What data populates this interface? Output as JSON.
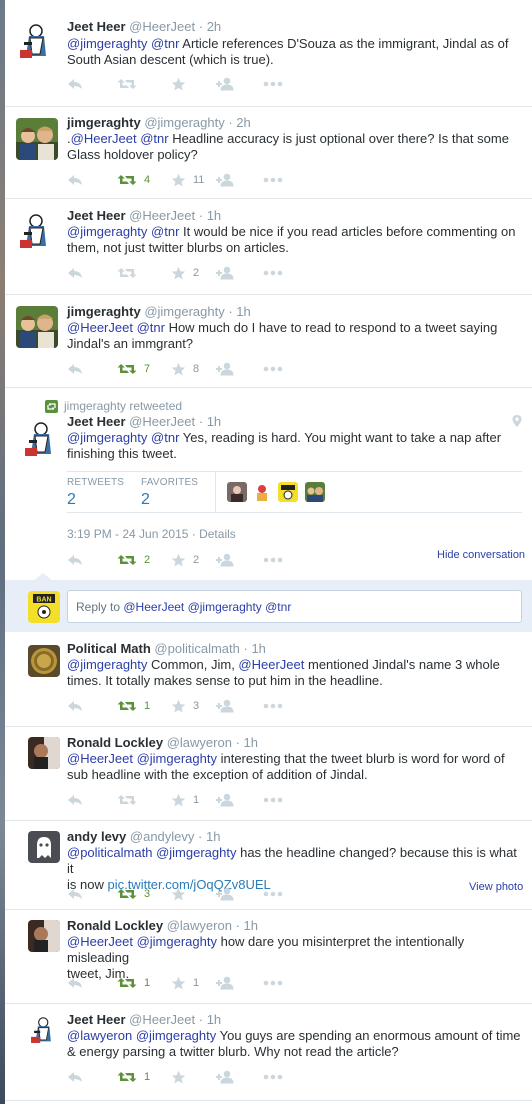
{
  "colors": {
    "link": "#2b3ea8",
    "retweet_active": "#5c913b",
    "muted": "#8899a6",
    "border": "#e1e8ed"
  },
  "tweets": [
    {
      "name": "Jeet Heer",
      "handle": "@HeerJeet",
      "time": "2h",
      "line1": [
        {
          "t": "@jimgeraghty",
          "m": true
        },
        {
          "t": " "
        },
        {
          "t": "@tnr",
          "m": true
        },
        {
          "t": " Article references D'Souza as the immigrant, Jindal as of"
        }
      ],
      "line2": "South Asian descent (which is true).",
      "retweets": "",
      "favorites": ""
    },
    {
      "name": "jimgeraghty",
      "handle": "@jimgeraghty",
      "time": "2h",
      "line1": [
        {
          "t": "."
        },
        {
          "t": "@HeerJeet",
          "m": true
        },
        {
          "t": "  "
        },
        {
          "t": "@tnr",
          "m": true
        },
        {
          "t": " Headline accuracy is just optional over there? Is that some"
        }
      ],
      "line2": "Glass holdover policy?",
      "retweets": "4",
      "favorites": "11"
    },
    {
      "name": "Jeet Heer",
      "handle": "@HeerJeet",
      "time": "1h",
      "line1": [
        {
          "t": "@jimgeraghty",
          "m": true
        },
        {
          "t": " "
        },
        {
          "t": "@tnr",
          "m": true
        },
        {
          "t": " It would be nice if you read articles before commenting on"
        }
      ],
      "line2": "them, not just twitter blurbs on articles.",
      "retweets": "",
      "favorites": "2"
    },
    {
      "name": "jimgeraghty",
      "handle": "@jimgeraghty",
      "time": "1h",
      "line1": [
        {
          "t": "@HeerJeet",
          "m": true
        },
        {
          "t": " "
        },
        {
          "t": "@tnr",
          "m": true
        },
        {
          "t": " How much do I have to read to respond to a tweet saying"
        }
      ],
      "line2": "Jindal's an immgrant?",
      "retweets": "7",
      "favorites": "8"
    }
  ],
  "focus": {
    "retweeted_by": "jimgeraghty retweeted",
    "name": "Jeet Heer",
    "handle": "@HeerJeet",
    "time": "1h",
    "line1": [
      {
        "t": "@jimgeraghty",
        "m": true
      },
      {
        "t": " "
      },
      {
        "t": "@tnr",
        "m": true
      },
      {
        "t": " Yes, reading is hard. You might want to take a nap after"
      }
    ],
    "line2": "finishing this tweet.",
    "retweets_label": "RETWEETS",
    "retweets": "2",
    "favorites_label": "FAVORITES",
    "favorites": "2",
    "timestamp": "3:19 PM - 24 Jun 2015",
    "details": "Details",
    "hide_conversation": "Hide conversation",
    "reply_prefix": "Reply to ",
    "reply_mentions": "@HeerJeet @jimgeraghty @tnr"
  },
  "replies": [
    {
      "name": "Political Math",
      "handle": "@politicalmath",
      "time": "1h",
      "line1": [
        {
          "t": "@jimgeraghty",
          "m": true
        },
        {
          "t": " Common, Jim, "
        },
        {
          "t": "@HeerJeet",
          "m": true
        },
        {
          "t": " mentioned Jindal's name 3 whole"
        }
      ],
      "line2": "times. It totally makes sense to put him in the headline.",
      "retweets": "1",
      "favorites": "3"
    },
    {
      "name": "Ronald Lockley",
      "handle": "@lawyeron",
      "time": "1h",
      "line1": [
        {
          "t": "@HeerJeet",
          "m": true
        },
        {
          "t": " "
        },
        {
          "t": "@jimgeraghty",
          "m": true
        },
        {
          "t": " interesting that the tweet blurb is word for word of"
        }
      ],
      "line2": "sub headline with the exception of addition of Jindal.",
      "retweets": "",
      "favorites": "1"
    },
    {
      "name": "andy levy",
      "handle": "@andylevy",
      "time": "1h",
      "line1": [
        {
          "t": "@politicalmath",
          "m": true
        },
        {
          "t": " "
        },
        {
          "t": "@jimgeraghty",
          "m": true
        },
        {
          "t": " has the headline changed? because this is what it"
        }
      ],
      "line2_prefix": "is now ",
      "line2_link": "pic.twitter.com/jOqQZv8UEL",
      "view_photo": "View photo",
      "retweets": "3",
      "favorites": ""
    },
    {
      "name": "Ronald Lockley",
      "handle": "@lawyeron",
      "time": "1h",
      "line1": [
        {
          "t": "@HeerJeet",
          "m": true
        },
        {
          "t": " "
        },
        {
          "t": "@jimgeraghty",
          "m": true
        },
        {
          "t": " how dare you misinterpret the intentionally misleading"
        }
      ],
      "line2": "tweet, Jim.",
      "retweets": "1",
      "favorites": "1"
    },
    {
      "name": "Jeet Heer",
      "handle": "@HeerJeet",
      "time": "1h",
      "line1": [
        {
          "t": "@lawyeron",
          "m": true
        },
        {
          "t": " "
        },
        {
          "t": "@jimgeraghty",
          "m": true
        },
        {
          "t": " You guys are spending an enormous amount of time"
        }
      ],
      "line2": "& energy parsing a twitter blurb. Why not read the article?",
      "retweets": "1",
      "favorites": ""
    }
  ]
}
